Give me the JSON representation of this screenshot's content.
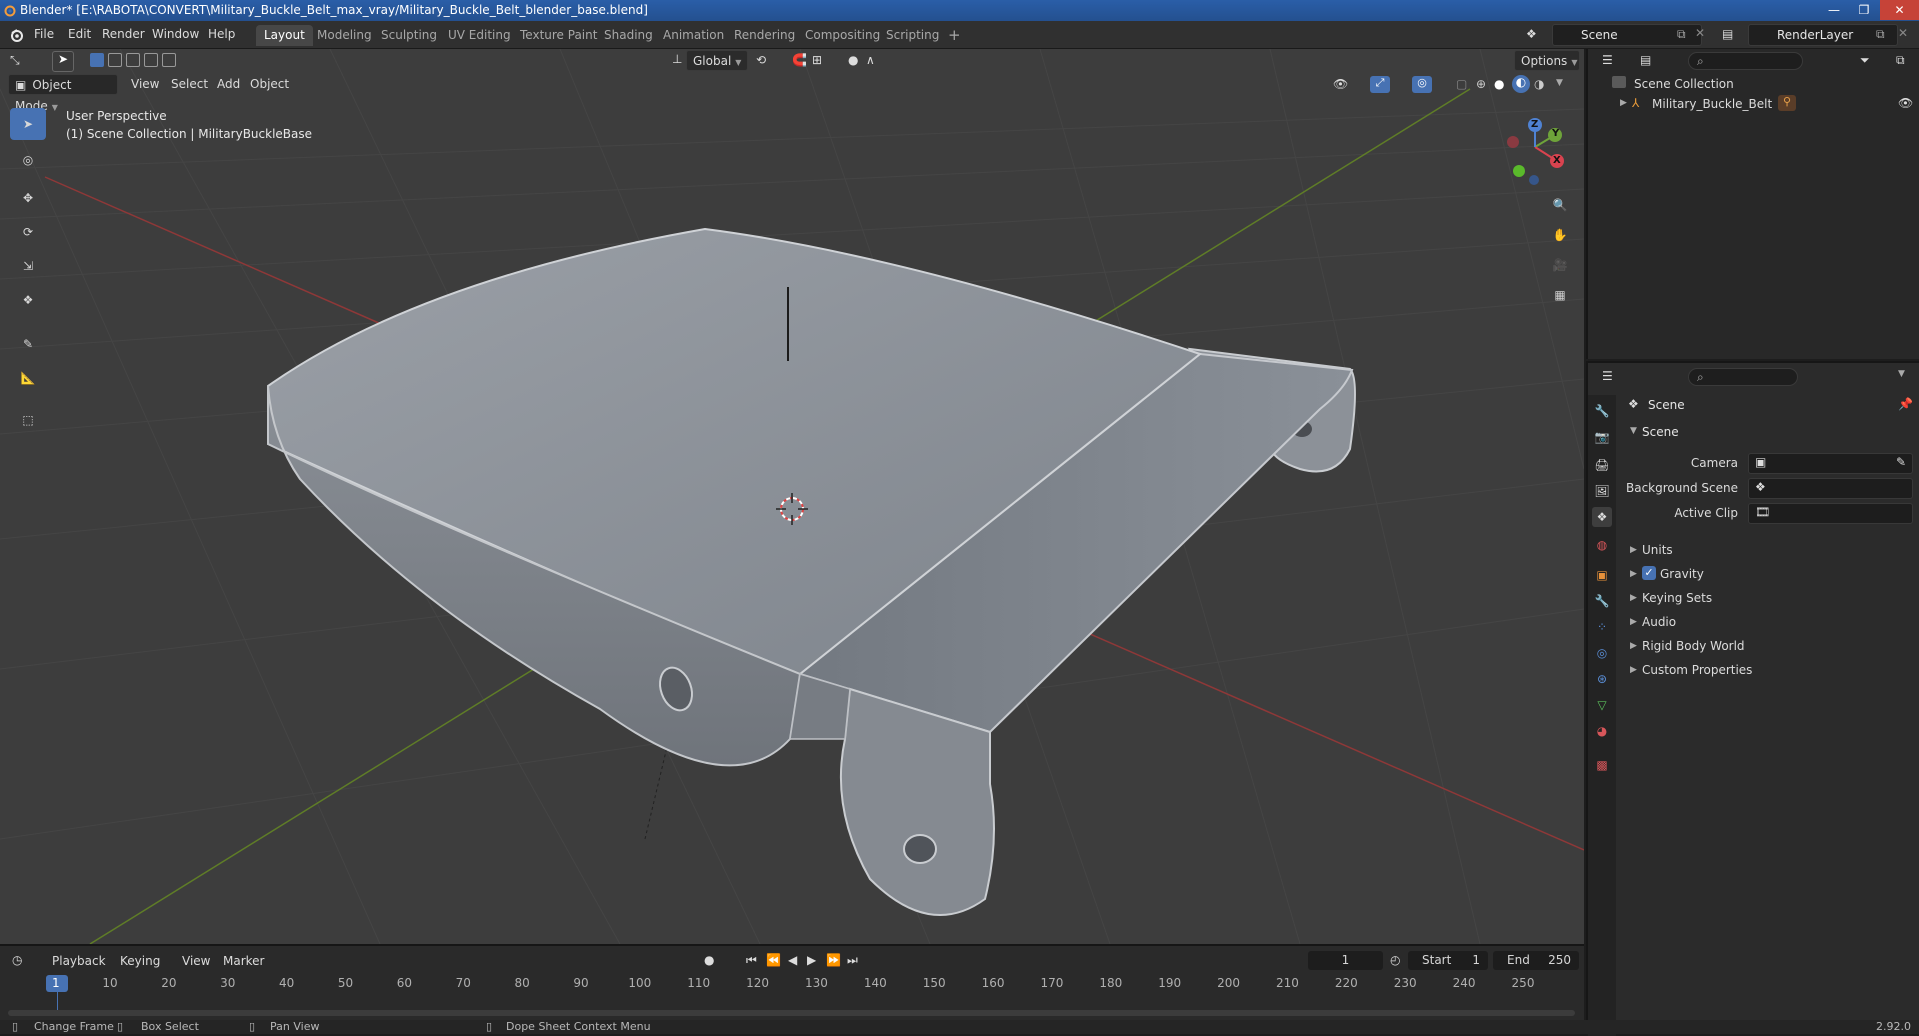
{
  "window": {
    "title": "Blender* [E:\\RABOTA\\CONVERT\\Military_Buckle_Belt_max_vray/Military_Buckle_Belt_blender_base.blend]",
    "controls": [
      "—",
      "❐",
      "✕"
    ]
  },
  "menubar": {
    "items": [
      "File",
      "Edit",
      "Render",
      "Window",
      "Help"
    ],
    "workspaces": [
      "Layout",
      "Modeling",
      "Sculpting",
      "UV Editing",
      "Texture Paint",
      "Shading",
      "Animation",
      "Rendering",
      "Compositing",
      "Scripting"
    ],
    "active_workspace": "Layout",
    "add_tab": "+",
    "scene_name": "Scene",
    "view_layer": "RenderLayer"
  },
  "viewport_header": {
    "mode": "Object Mode",
    "menus": [
      "View",
      "Select",
      "Add",
      "Object"
    ],
    "transform_orientation": "Global",
    "options_label": "Options"
  },
  "viewport": {
    "perspective_label": "User Perspective",
    "collection_label": "(1) Scene Collection | MilitaryBuckleBase",
    "gizmo": {
      "x": "X",
      "y": "Y",
      "z": "Z"
    },
    "colors": {
      "background": "#3d3d3d",
      "grid": "#4a4a4a",
      "x_axis": "#9b3a3a",
      "y_axis": "#6b8a2c",
      "object": "#8c9097"
    }
  },
  "outliner": {
    "root": "Scene Collection",
    "items": [
      {
        "label": "Military_Buckle_Belt"
      }
    ]
  },
  "properties": {
    "context_label": "Scene",
    "panel_title": "Scene",
    "fields": [
      {
        "label": "Camera"
      },
      {
        "label": "Background Scene"
      },
      {
        "label": "Active Clip"
      }
    ],
    "subpanels": [
      {
        "label": "Units",
        "checkbox": false
      },
      {
        "label": "Gravity",
        "checkbox": true
      },
      {
        "label": "Keying Sets",
        "checkbox": false
      },
      {
        "label": "Audio",
        "checkbox": false
      },
      {
        "label": "Rigid Body World",
        "checkbox": false
      },
      {
        "label": "Custom Properties",
        "checkbox": false
      }
    ]
  },
  "timeline": {
    "menus": [
      "Playback",
      "Keying",
      "View",
      "Marker"
    ],
    "current_frame": "1",
    "start_label": "Start",
    "start_value": "1",
    "end_label": "End",
    "end_value": "250",
    "ticks": [
      "1",
      "10",
      "20",
      "30",
      "40",
      "50",
      "60",
      "70",
      "80",
      "90",
      "100",
      "110",
      "120",
      "130",
      "140",
      "150",
      "160",
      "170",
      "180",
      "190",
      "200",
      "210",
      "220",
      "230",
      "240",
      "250"
    ]
  },
  "statusbar": {
    "hints": [
      "Change Frame",
      "Box Select",
      "Pan View",
      "Dope Sheet Context Menu"
    ],
    "version": "2.92.0"
  }
}
